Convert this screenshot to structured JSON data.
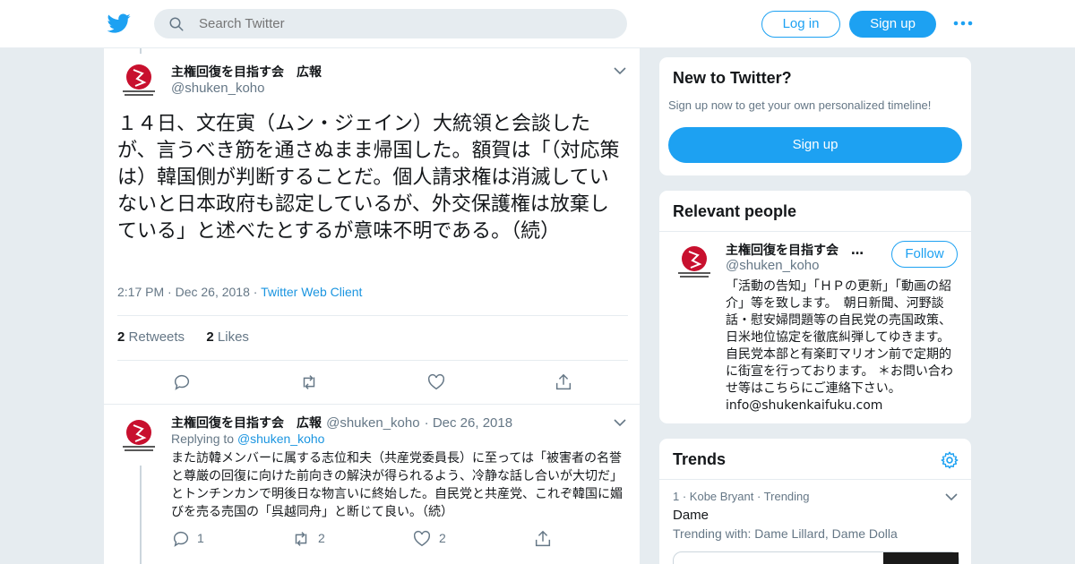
{
  "colors": {
    "accent": "#1da1f2",
    "link": "#1b95e0",
    "muted": "#657786",
    "bg": "#e6ecf0"
  },
  "header": {
    "logo_icon": "twitter-bird-icon",
    "search_placeholder": "Search Twitter",
    "login_label": "Log in",
    "signup_label": "Sign up",
    "more_icon": "more-dots-icon"
  },
  "tweet": {
    "author_name": "主権回復を目指す会　広報",
    "author_handle": "@shuken_koho",
    "text": "１４日、文在寅（ムン・ジェイン）大統領と会談したが、言うべき筋を通さぬまま帰国した。額賀は「（対応策は）韓国側が判断することだ。個人請求権は消滅していないと日本政府も認定しているが、外交保護権は放棄している」と述べたとするが意味不明である。（続）",
    "time": "2:17 PM",
    "date": "Dec 26, 2018",
    "source": "Twitter Web Client",
    "retweets_count": "2",
    "retweets_label": "Retweets",
    "likes_count": "2",
    "likes_label": "Likes"
  },
  "reply": {
    "author_name": "主権回復を目指す会　広報",
    "author_handle": "@shuken_koho",
    "date": "Dec 26, 2018",
    "replying_label": "Replying to",
    "replying_handle": "@shuken_koho",
    "text": "また訪韓メンバーに属する志位和夫（共産党委員長）に至っては「被害者の名誉と尊厳の回復に向けた前向きの解決が得られるよう、冷静な話し合いが大切だ」とトンチンカンで明後日な物言いに終始した。自民党と共産党、これぞ韓国に媚びを売る売国の「呉越同舟」と断じて良い。（続）",
    "reply_count": "1",
    "retweet_count": "2",
    "like_count": "2"
  },
  "new_to_twitter": {
    "title": "New to Twitter?",
    "subtitle": "Sign up now to get your own personalized timeline!",
    "signup_label": "Sign up"
  },
  "relevant_people": {
    "title": "Relevant people",
    "name": "主権回復を目指す会　…",
    "handle": "@shuken_koho",
    "follow_label": "Follow",
    "bio": "「活動の告知」「ＨＰの更新」「動画の紹介」等を致します。　朝日新聞、河野談話・慰安婦問題等の自民党の売国政策、日米地位協定を徹底糾弾してゆきます。　自民党本部と有楽町マリオン前で定期的に街宣を行っております。 ＊お問い合わせ等はこちらにご連絡下さい。info@shukenkaifuku.com"
  },
  "trends": {
    "title": "Trends",
    "settings_icon": "gear-icon",
    "items": [
      {
        "rank": "1",
        "context": "Kobe Bryant",
        "status": "Trending",
        "name": "Dame",
        "with": "Trending with: Dame Lillard, Dame Dolla"
      }
    ]
  }
}
